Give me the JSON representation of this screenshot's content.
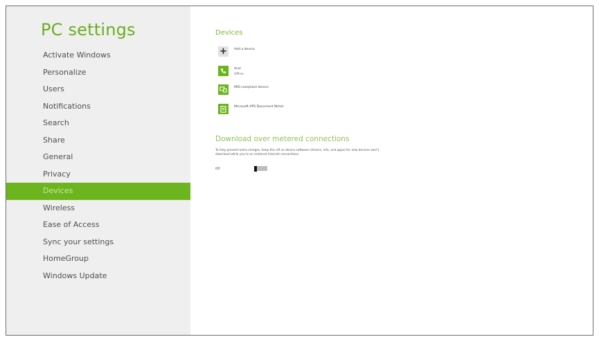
{
  "app": {
    "title": "PC settings"
  },
  "sidebar": {
    "items": [
      {
        "label": "Activate Windows"
      },
      {
        "label": "Personalize"
      },
      {
        "label": "Users"
      },
      {
        "label": "Notifications"
      },
      {
        "label": "Search"
      },
      {
        "label": "Share"
      },
      {
        "label": "General"
      },
      {
        "label": "Privacy"
      },
      {
        "label": "Devices",
        "selected": true
      },
      {
        "label": "Wireless"
      },
      {
        "label": "Ease of Access"
      },
      {
        "label": "Sync your settings"
      },
      {
        "label": "HomeGroup"
      },
      {
        "label": "Windows Update"
      }
    ]
  },
  "devices": {
    "title": "Devices",
    "items": [
      {
        "name": "Add a device",
        "status": "",
        "icon": "plus-icon"
      },
      {
        "name": "Acer",
        "status": "Offline",
        "icon": "phone-icon"
      },
      {
        "name": "MID compliant device",
        "status": "",
        "icon": "device-icon"
      },
      {
        "name": "Microsoft XPS Document Writer",
        "status": "",
        "icon": "printer-icon"
      }
    ]
  },
  "metered": {
    "title": "Download over metered connections",
    "description": "To help prevent extra charges, keep this off so device software (drivers, info, and apps) for new devices won't download while you're on metered Internet connections.",
    "toggle_label": "Off",
    "toggle_on": false
  },
  "colors": {
    "accent": "#6db51e",
    "sidebar_bg": "#efefef",
    "title_green": "#6cad1f"
  }
}
